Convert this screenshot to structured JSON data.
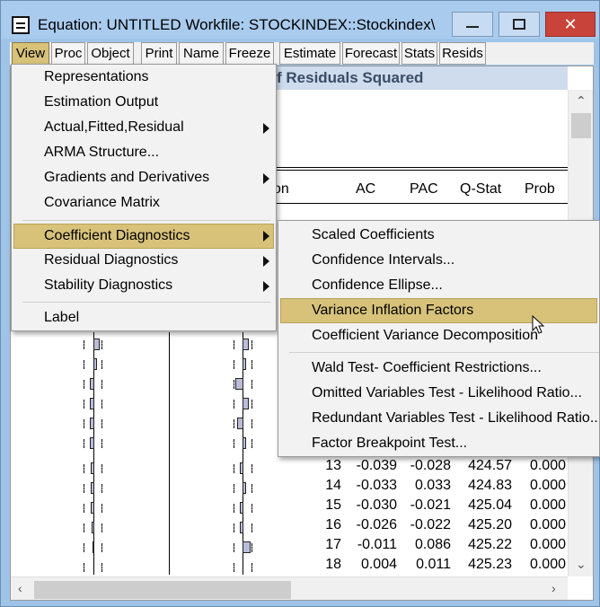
{
  "window": {
    "title": "Equation: UNTITLED   Workfile: STOCKINDEX::Stockindex\\",
    "minimize_label": "",
    "maximize_label": "",
    "close_label": "✕"
  },
  "toolbar": [
    "View",
    "Proc",
    "Object",
    "Print",
    "Name",
    "Freeze",
    "Estimate",
    "Forecast",
    "Stats",
    "Resids"
  ],
  "content": {
    "banner_text": "f Residuals Squared",
    "columns": {
      "partial_label": "tion",
      "ac": "AC",
      "pac": "PAC",
      "qstat": "Q-Stat",
      "prob": "Prob"
    },
    "rows": [
      {
        "lag": "13",
        "ac": "-0.039",
        "pac": "-0.028",
        "q": "424.57",
        "prob": "0.000"
      },
      {
        "lag": "14",
        "ac": "-0.033",
        "pac": "0.033",
        "q": "424.83",
        "prob": "0.000"
      },
      {
        "lag": "15",
        "ac": "-0.030",
        "pac": "-0.021",
        "q": "425.04",
        "prob": "0.000"
      },
      {
        "lag": "16",
        "ac": "-0.026",
        "pac": "-0.022",
        "q": "425.20",
        "prob": "0.000"
      },
      {
        "lag": "17",
        "ac": "-0.011",
        "pac": "0.086",
        "q": "425.22",
        "prob": "0.000"
      },
      {
        "lag": "18",
        "ac": "0.004",
        "pac": "0.011",
        "q": "425.23",
        "prob": "0.000"
      }
    ]
  },
  "view_menu": {
    "items": [
      "Representations",
      "Estimation Output",
      "Actual,Fitted,Residual",
      "ARMA Structure...",
      "Gradients and Derivatives",
      "Covariance Matrix",
      "Coefficient Diagnostics",
      "Residual Diagnostics",
      "Stability Diagnostics",
      "Label"
    ],
    "highlighted": "Coefficient Diagnostics"
  },
  "coef_submenu": {
    "items": [
      "Scaled Coefficients",
      "Confidence Intervals...",
      "Confidence Ellipse...",
      "Variance Inflation Factors",
      "Coefficient Variance Decomposition",
      "Wald Test- Coefficient Restrictions...",
      "Omitted Variables Test - Likelihood Ratio...",
      "Redundant Variables Test - Likelihood Ratio...",
      "Factor Breakpoint Test..."
    ],
    "highlighted": "Variance Inflation Factors"
  },
  "colors": {
    "highlight": "#d8c27a",
    "titlebar": "#a9cbee",
    "banner": "#cfdced"
  }
}
